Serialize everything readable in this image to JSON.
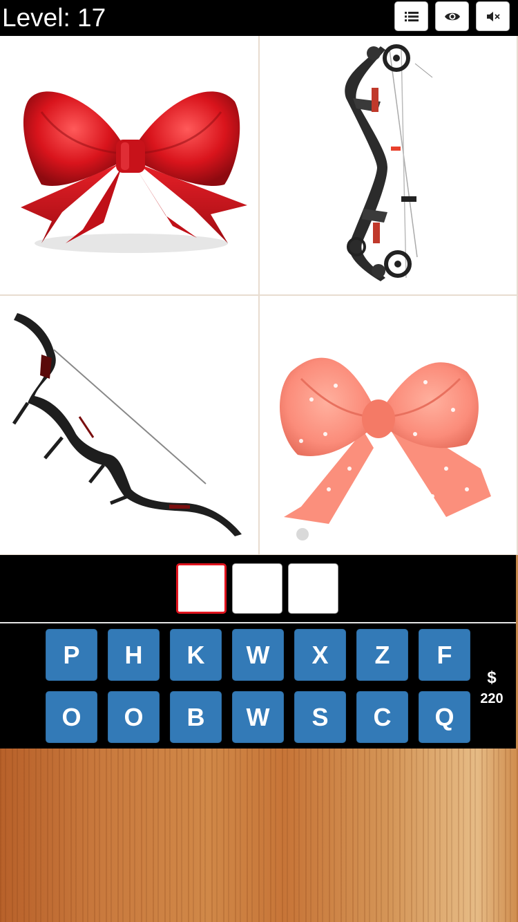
{
  "header": {
    "level_label": "Level: 17",
    "buttons": [
      {
        "name": "list-icon"
      },
      {
        "name": "eye-icon"
      },
      {
        "name": "mute-icon"
      }
    ]
  },
  "images": [
    {
      "name": "red-ribbon-bow-image",
      "color": "#d9141c"
    },
    {
      "name": "compound-bow-image",
      "color": "#2b2b2b"
    },
    {
      "name": "recurve-bow-image",
      "color": "#1e1e1e"
    },
    {
      "name": "pink-hair-bow-image",
      "color": "#fb8c7a"
    }
  ],
  "answer": {
    "slots": [
      "",
      "",
      ""
    ],
    "active_index": 0,
    "active_color": "#e0141e"
  },
  "keyboard": {
    "rows": [
      [
        "P",
        "H",
        "K",
        "W",
        "X",
        "Z",
        "F"
      ],
      [
        "O",
        "O",
        "B",
        "W",
        "S",
        "C",
        "Q"
      ]
    ],
    "key_color": "#337ab7"
  },
  "coins": {
    "symbol": "$",
    "amount": "220"
  }
}
